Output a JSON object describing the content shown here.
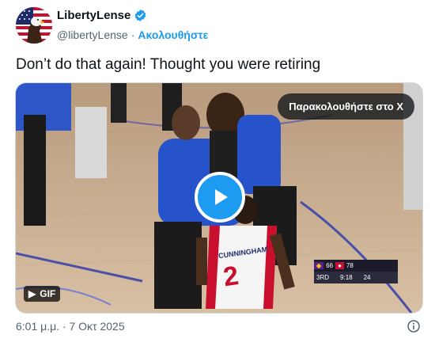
{
  "account": {
    "name": "LibertyLense",
    "handle": "@libertyLense",
    "separator": "·",
    "follow_label": "Ακολουθήστε"
  },
  "tweet": {
    "text": "Don’t do that again! Thought you were retiring"
  },
  "media": {
    "watch_label": "Παρακολουθήστε στο X",
    "gif_label": "GIF",
    "scorebug": {
      "team1_score": "66",
      "team2_score": "78",
      "quarter": "3RD",
      "clock": "9:18",
      "shot_clock": "24"
    },
    "jersey_name": "CUNNINGHAM",
    "jersey_number": "2"
  },
  "footer": {
    "timestamp": "6:01 μ.μ. · 7 Οκτ 2025"
  },
  "colors": {
    "accent": "#1d9bf0",
    "text": "#0f1419",
    "muted": "#536471"
  }
}
